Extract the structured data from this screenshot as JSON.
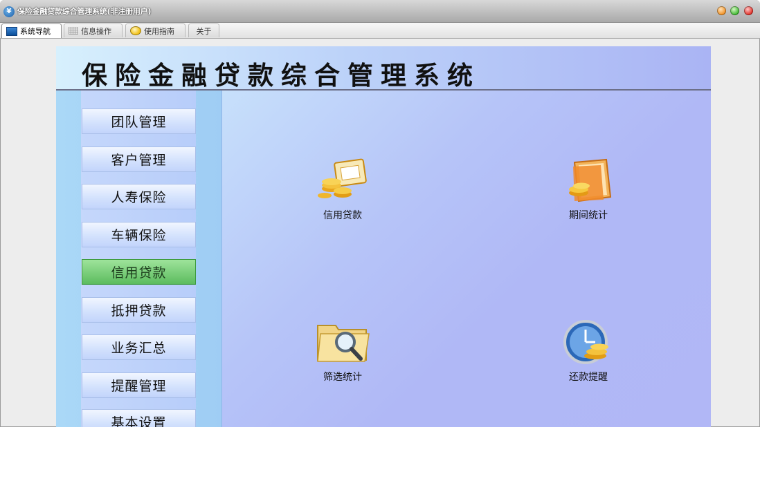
{
  "window": {
    "title": "保险金融贷款综合管理系统(非注册用户)"
  },
  "tabs": [
    {
      "label": "系统导航",
      "icon": "monitor-icon"
    },
    {
      "label": "信息操作",
      "icon": "grid-icon"
    },
    {
      "label": "使用指南",
      "icon": "guide-icon"
    },
    {
      "label": "关于",
      "icon": ""
    }
  ],
  "banner": {
    "title": "保险金融贷款综合管理系统"
  },
  "sidebar": {
    "items": [
      {
        "label": "团队管理"
      },
      {
        "label": "客户管理"
      },
      {
        "label": "人寿保险"
      },
      {
        "label": "车辆保险"
      },
      {
        "label": "信用贷款"
      },
      {
        "label": "抵押贷款"
      },
      {
        "label": "业务汇总"
      },
      {
        "label": "提醒管理"
      },
      {
        "label": "基本设置"
      }
    ]
  },
  "features": [
    {
      "label": "信用贷款",
      "icon": "coins-card-icon"
    },
    {
      "label": "期间统计",
      "icon": "coins-folder-icon"
    },
    {
      "label": "筛选统计",
      "icon": "folder-search-icon"
    },
    {
      "label": "还款提醒",
      "icon": "clock-coins-icon"
    }
  ],
  "colors": {
    "active_item": "#5cbc5e",
    "panel_bg": "#b1b8f6"
  }
}
